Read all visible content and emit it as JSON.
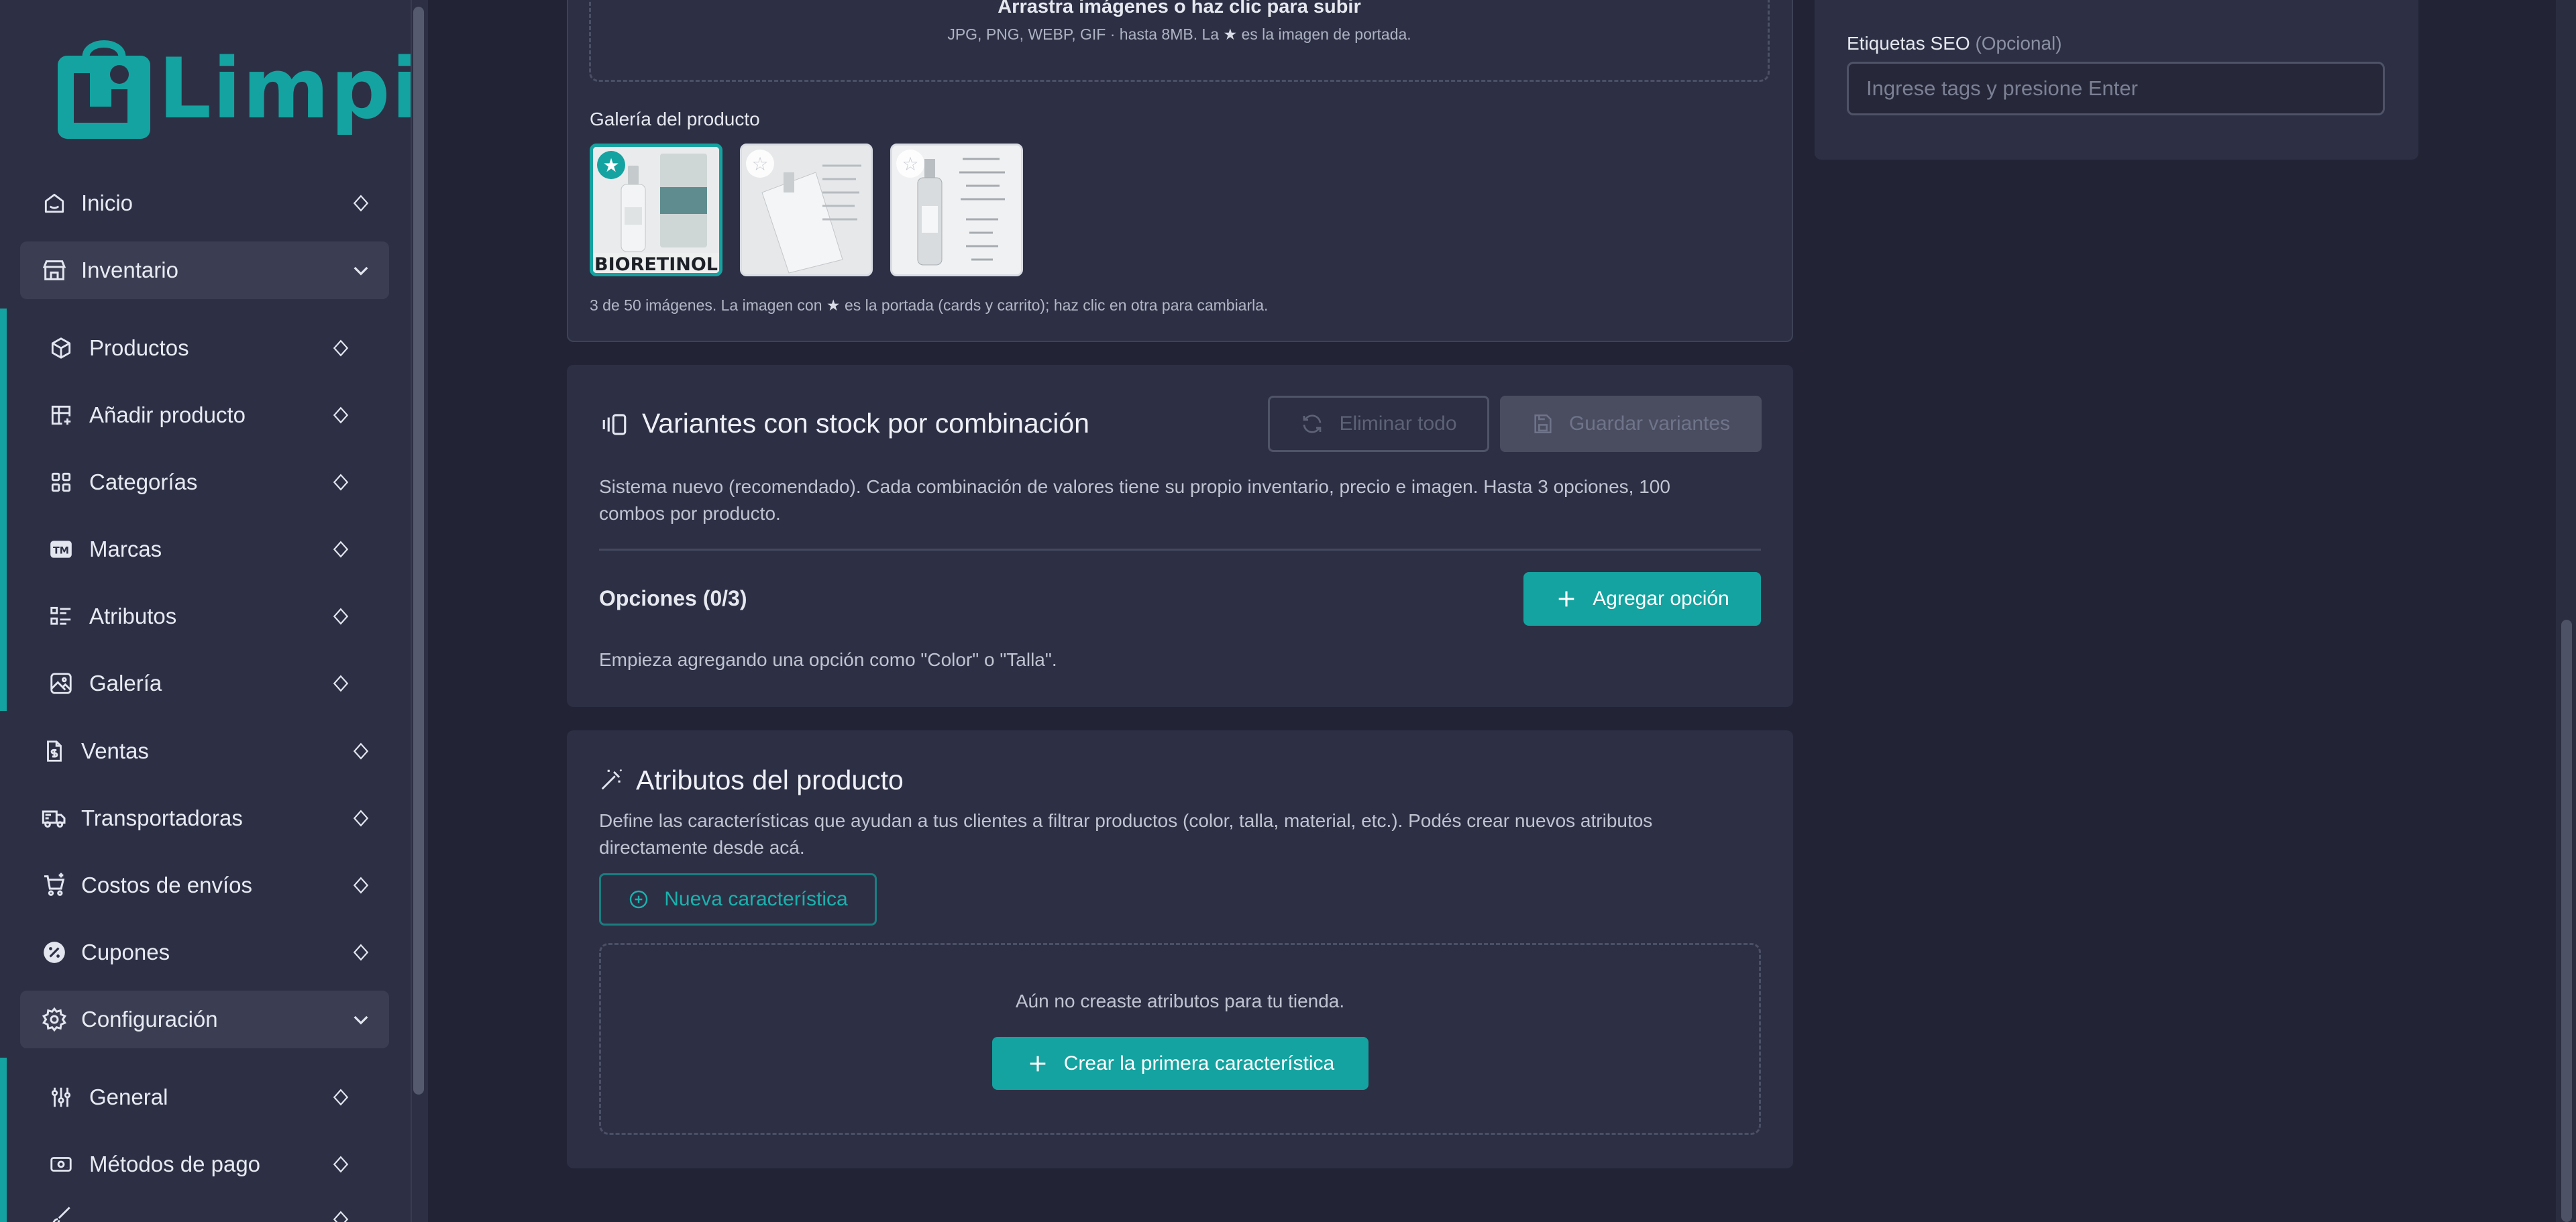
{
  "brand": {
    "name": "Limpi",
    "accent": "#14a3a0"
  },
  "sidebar": {
    "items": [
      {
        "label": "Inicio",
        "icon": "home-icon"
      },
      {
        "label": "Inventario",
        "icon": "store-icon",
        "expanded": true
      },
      {
        "label": "Productos",
        "icon": "box-icon"
      },
      {
        "label": "Añadir producto",
        "icon": "table-plus-icon"
      },
      {
        "label": "Categorías",
        "icon": "grid-icon"
      },
      {
        "label": "Marcas",
        "icon": "trademark-icon"
      },
      {
        "label": "Atributos",
        "icon": "list-details-icon"
      },
      {
        "label": "Galería",
        "icon": "photo-icon"
      },
      {
        "label": "Ventas",
        "icon": "receipt-dollar-icon"
      },
      {
        "label": "Transportadoras",
        "icon": "truck-icon"
      },
      {
        "label": "Costos de envíos",
        "icon": "cart-plus-icon"
      },
      {
        "label": "Cupones",
        "icon": "discount-icon"
      },
      {
        "label": "Configuración",
        "icon": "settings-icon",
        "expanded": true
      },
      {
        "label": "General",
        "icon": "adjustments-icon"
      },
      {
        "label": "Métodos de pago",
        "icon": "cash-icon"
      }
    ]
  },
  "gallery": {
    "upload_title": "Arrastra imágenes o haz clic para subir",
    "upload_hint_before": "JPG, PNG, WEBP, GIF · hasta 8MB. La",
    "upload_hint_after": "es la imagen de portada.",
    "title": "Galería del producto",
    "thumb_label": "BIORETINOL",
    "summary_before": "3 de 50 imágenes. La imagen con",
    "summary_after": "es la portada (cards y carrito); haz clic en otra para cambiarla."
  },
  "variants": {
    "title": "Variantes con stock por combinación",
    "delete_all_label": "Eliminar todo",
    "save_label": "Guardar variantes",
    "description": "Sistema nuevo (recomendado). Cada combinación de valores tiene su propio inventario, precio e imagen. Hasta 3 opciones, 100",
    "description_line2": "combos por producto.",
    "options_label": "Opciones (0/3)",
    "add_option_label": "Agregar opción",
    "empty_hint": "Empieza agregando una opción como \"Color\" o \"Talla\"."
  },
  "attributes": {
    "title": "Atributos del producto",
    "description": "Define las características que ayudan a tus clientes a filtrar productos (color, talla, material, etc.). Podés crear nuevos atributos",
    "description_line2": "directamente desde acá.",
    "new_label": "Nueva característica",
    "empty_text": "Aún no creaste atributos para tu tienda.",
    "create_first_label": "Crear la primera característica"
  },
  "seo": {
    "label": "Etiquetas SEO",
    "optional": "(Opcional)",
    "placeholder": "Ingrese tags y presione Enter"
  }
}
